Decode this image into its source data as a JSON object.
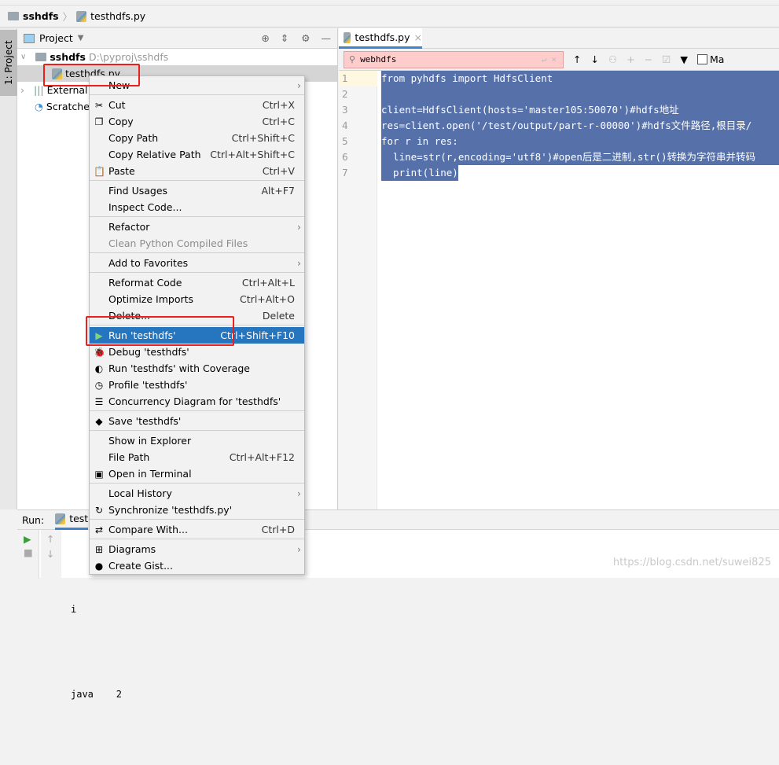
{
  "breadcrumb": {
    "project": "sshdfs",
    "file": "testhdfs.py"
  },
  "left_stripe": {
    "project_tab": "1: Project"
  },
  "project_panel": {
    "title": "Project",
    "root": "sshdfs",
    "root_path": "D:\\pyproj\\sshdfs",
    "file": "testhdfs.py",
    "external": "External",
    "scratches": "Scratches"
  },
  "editor": {
    "tab": "testhdfs.py",
    "search_value": "webhdfs",
    "match_case_label": "Ma",
    "line_numbers": [
      "1",
      "2",
      "3",
      "4",
      "5",
      "6",
      "7"
    ],
    "lines": [
      "from pyhdfs import HdfsClient",
      "",
      "client=HdfsClient(hosts='master105:50070')#hdfs地址",
      "res=client.open('/test/output/part-r-00000')#hdfs文件路径,根目录/",
      "for r in res:",
      "  line=str(r,encoding='utf8')#open后是二进制,str()转换为字符串并转码",
      "  print(line)"
    ]
  },
  "run_panel": {
    "label": "Run:",
    "tab": "test",
    "output": [
      "i",
      "java    2"
    ]
  },
  "context_menu": [
    {
      "label": "New",
      "sub": true
    },
    "sep",
    {
      "label": "Cut",
      "shortcut": "Ctrl+X",
      "icon": "cut-icon",
      "glyph": "✂"
    },
    {
      "label": "Copy",
      "shortcut": "Ctrl+C",
      "icon": "copy-icon",
      "glyph": "❐"
    },
    {
      "label": "Copy Path",
      "shortcut": "Ctrl+Shift+C"
    },
    {
      "label": "Copy Relative Path",
      "shortcut": "Ctrl+Alt+Shift+C"
    },
    {
      "label": "Paste",
      "shortcut": "Ctrl+V",
      "icon": "paste-icon",
      "glyph": "📋"
    },
    "sep",
    {
      "label": "Find Usages",
      "shortcut": "Alt+F7"
    },
    {
      "label": "Inspect Code..."
    },
    "sep",
    {
      "label": "Refactor",
      "sub": true
    },
    {
      "label": "Clean Python Compiled Files",
      "disabled": true
    },
    "sep",
    {
      "label": "Add to Favorites",
      "sub": true
    },
    "sep",
    {
      "label": "Reformat Code",
      "shortcut": "Ctrl+Alt+L"
    },
    {
      "label": "Optimize Imports",
      "shortcut": "Ctrl+Alt+O"
    },
    {
      "label": "Delete...",
      "shortcut": "Delete"
    },
    "sep",
    {
      "label": "Run 'testhdfs'",
      "shortcut": "Ctrl+Shift+F10",
      "icon": "run-icon",
      "glyph": "▶",
      "highlight": true
    },
    {
      "label": "Debug 'testhdfs'",
      "icon": "debug-icon",
      "glyph": "🐞"
    },
    {
      "label": "Run 'testhdfs' with Coverage",
      "icon": "coverage-icon",
      "glyph": "◐"
    },
    {
      "label": "Profile 'testhdfs'",
      "icon": "profile-icon",
      "glyph": "◷"
    },
    {
      "label": "Concurrency Diagram for 'testhdfs'",
      "icon": "concurrency-diagram-icon",
      "glyph": "☰"
    },
    "sep",
    {
      "label": "Save 'testhdfs'",
      "icon": "python-icon",
      "glyph": "◆"
    },
    "sep",
    {
      "label": "Show in Explorer"
    },
    {
      "label": "File Path",
      "shortcut": "Ctrl+Alt+F12"
    },
    {
      "label": "Open in Terminal",
      "icon": "terminal-icon",
      "glyph": "▣"
    },
    "sep",
    {
      "label": "Local History",
      "sub": true
    },
    {
      "label": "Synchronize 'testhdfs.py'",
      "icon": "sync-icon",
      "glyph": "↻"
    },
    "sep",
    {
      "label": "Compare With...",
      "shortcut": "Ctrl+D",
      "icon": "compare-icon",
      "glyph": "⇄"
    },
    "sep",
    {
      "label": "Diagrams",
      "sub": true,
      "icon": "diagrams-icon",
      "glyph": "⊞"
    },
    {
      "label": "Create Gist...",
      "icon": "github-icon",
      "glyph": "●"
    }
  ],
  "watermark": "https://blog.csdn.net/suwei825",
  "colors": {
    "selection": "#5670a9",
    "menu_highlight": "#2675bf",
    "search_bg": "#ffcccc",
    "annotation_box": "#e8211c"
  }
}
